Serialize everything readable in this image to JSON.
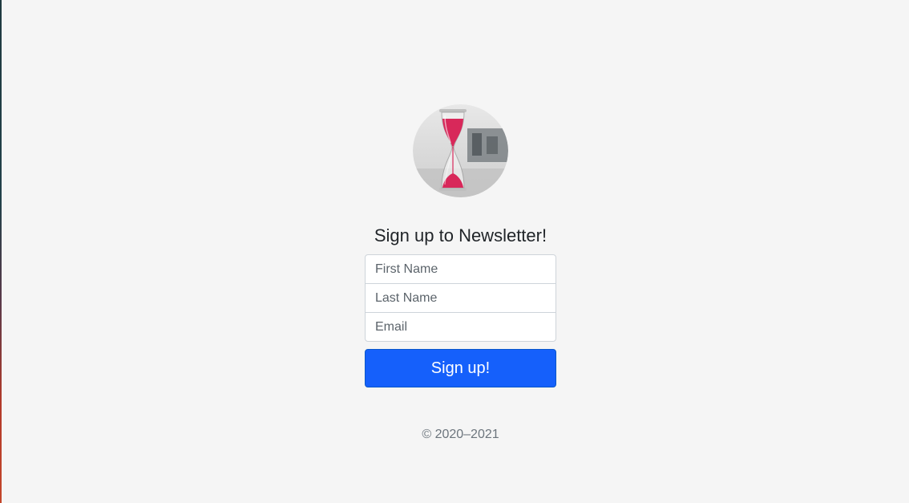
{
  "signup_form": {
    "heading": "Sign up to Newsletter!",
    "first_name_placeholder": "First Name",
    "last_name_placeholder": "Last Name",
    "email_placeholder": "Email",
    "submit_label": "Sign up!",
    "footer": "© 2020–2021"
  },
  "colors": {
    "page_background": "#f5f5f5",
    "button_primary": "#1560fb",
    "hourglass_sand": "#d8285a"
  },
  "icons": {
    "logo": "hourglass-logo"
  }
}
